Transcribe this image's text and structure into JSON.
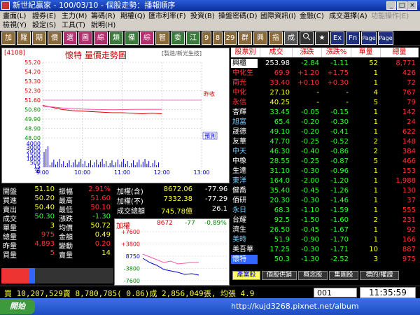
{
  "title": "新世紀贏家 - 100/03/10 - 個股走勢：播報順序",
  "menu_row1": [
    "畫面(L)",
    "證券(E)",
    "主力(M)",
    "籌碼(R)",
    "期權(Q)",
    "匯市利率(F)",
    "投資(B)",
    "操盤密碼(D)",
    "國際資訊(I)",
    "金融(C)",
    "成交選擇(A)",
    "功能操作(E)"
  ],
  "menu_row2": [
    "檢視(Y)",
    "設定(S)",
    "工具(T)",
    "說明(H)"
  ],
  "toolbar": [
    "加",
    "羅",
    "期",
    "價",
    "選",
    "圖",
    "綜",
    "類",
    "備",
    "綜",
    "智",
    "委",
    "江",
    "9",
    "8",
    "29",
    "群",
    "興",
    "指",
    "成",
    "Ex",
    "Fn",
    "Page",
    "Page"
  ],
  "chart": {
    "code": "[4108]",
    "title": "懷特  量價走勢圖",
    "subtitle": "[製造/新光生技]",
    "y_labels": [
      "55.20",
      "54.20",
      "53.30",
      "52.30",
      "51.60",
      "50.80",
      "49.90",
      "48.90",
      "48.00"
    ],
    "vol_labels": [
      "4000",
      "3000",
      "2000",
      "1500",
      "1000",
      "500",
      "15",
      "張"
    ],
    "x_labels": [
      "9:00",
      "10:00",
      "11:00",
      "12:00",
      "13:00"
    ],
    "ref_label": "昨收",
    "forecast_label": "預測"
  },
  "chart_data": {
    "type": "line",
    "x": [
      "09:00",
      "09:15",
      "09:30",
      "09:45",
      "10:00",
      "10:15",
      "10:30",
      "10:45",
      "11:00",
      "11:15",
      "11:30",
      "11:45",
      "12:00"
    ],
    "series": [
      {
        "values": [
          51.1,
          50.9,
          50.7,
          50.6,
          50.55,
          50.5,
          50.45,
          50.4,
          50.4,
          50.35,
          50.3,
          50.35,
          50.3
        ]
      },
      {
        "values": [
          51.0,
          50.95,
          50.85,
          50.8,
          50.75,
          50.72,
          50.7,
          50.68,
          50.7,
          50.72,
          50.72,
          50.73,
          50.72
        ]
      }
    ],
    "ylim": [
      48.0,
      55.2
    ]
  },
  "quote": [
    [
      "開盤",
      "51.10",
      "振幅",
      "2.91%"
    ],
    [
      "買進",
      "50.20",
      "最高",
      "51.60"
    ],
    [
      "賣出",
      "50.40",
      "最低",
      "50.10"
    ],
    [
      "成交",
      "50.30",
      "漲跌",
      "-1.30"
    ],
    [
      "單量",
      "3",
      "均價",
      "50.72"
    ],
    [
      "總量",
      "975",
      "金額",
      "0.49"
    ],
    [
      "昨量",
      "4,893",
      "變動",
      "0.20"
    ],
    [
      "買量",
      "5",
      "賣量",
      "14"
    ]
  ],
  "index": [
    [
      "加權(含)",
      "8672.06",
      "-77.96"
    ],
    [
      "加權(不)",
      "7332.38",
      "-77.29"
    ],
    [
      "成交總額",
      "745.78億",
      "26.1"
    ]
  ],
  "subchart": {
    "title": "加權",
    "value": "8672",
    "change": "-77",
    "pct": "-0.89%",
    "y_labels": [
      "+7600",
      "+3800",
      "8750",
      "-3800",
      "-7600"
    ]
  },
  "headers": [
    "股票別",
    "成交",
    "漲跌",
    "漲跌%",
    "單量",
    "總量"
  ],
  "rows": [
    [
      "興櫃",
      "253.98",
      "-2.84",
      "-1.11",
      "52",
      "8,771"
    ],
    [
      "中化生",
      "69.9",
      "+1.20",
      "+1.75",
      "1",
      "426"
    ],
    [
      "南光",
      "33.40",
      "+0.10",
      "+0.30",
      "1",
      "72"
    ],
    [
      "中化",
      "27.10",
      "-",
      "-",
      "4",
      "767"
    ],
    [
      "永信",
      "40.25",
      "-",
      "-",
      "5",
      "79"
    ],
    [
      "杏輝",
      "33.45",
      "-0.05",
      "-0.15",
      "1",
      "142"
    ],
    [
      "旭富",
      "65.4",
      "-0.20",
      "-0.30",
      "1",
      "24"
    ],
    [
      "晟德",
      "49.10",
      "-0.20",
      "-0.41",
      "1",
      "622"
    ],
    [
      "友華",
      "47.70",
      "-0.25",
      "-0.52",
      "2",
      "148"
    ],
    [
      "中天",
      "46.30",
      "-0.40",
      "-0.86",
      "2",
      "384"
    ],
    [
      "中橡",
      "28.55",
      "-0.25",
      "-0.87",
      "5",
      "466"
    ],
    [
      "生達",
      "31.10",
      "-0.30",
      "-0.96",
      "1",
      "153"
    ],
    [
      "東洋",
      "164.0",
      "-2.00",
      "-1.20",
      "1",
      "1,988"
    ],
    [
      "健喬",
      "35.40",
      "-0.45",
      "-1.26",
      "1",
      "130"
    ],
    [
      "佰研",
      "20.30",
      "-0.30",
      "-1.46",
      "1",
      "37"
    ],
    [
      "永日",
      "68.3",
      "-1.10",
      "-1.59",
      "1",
      "555"
    ],
    [
      "台耀",
      "92.5",
      "-1.50",
      "-1.60",
      "2",
      "231"
    ],
    [
      "濟生",
      "26.50",
      "-0.45",
      "-1.67",
      "1",
      "92"
    ],
    [
      "美時",
      "51.9",
      "-0.90",
      "-1.70",
      "1",
      "166"
    ],
    [
      "美吾華",
      "17.25",
      "-0.30",
      "-1.71",
      "10",
      "887"
    ],
    [
      "懷特",
      "50.3",
      "-1.30",
      "-2.52",
      "3",
      "975"
    ]
  ],
  "tabs": [
    "產業股",
    "個股供銷",
    "概念股",
    "集團股",
    "標的/權證"
  ],
  "status": {
    "ticker": "買 10,207,529賣 8,780,785( 0.86)成 2,856,049張, 均張 4.9",
    "code": "001",
    "time": "11:35:59"
  },
  "taskbar": {
    "start": "開始",
    "url": "http://kujd3268.pixnet.net/album"
  },
  "colors": {
    "up": "#ff3333",
    "down": "#33ff33",
    "flat": "#ffffff",
    "header": "#dd0000"
  }
}
